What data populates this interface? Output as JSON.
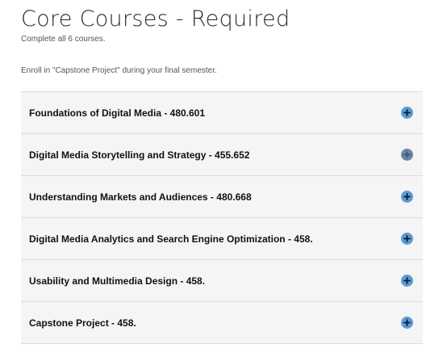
{
  "header": {
    "title": "Core Courses - Required",
    "subtitle": "Complete all 6 courses.",
    "note": "Enroll in \"Capstone Project\" during your final semester."
  },
  "courses": [
    {
      "label": "Foundations of Digital Media - 480.601",
      "icon": "plus-circle-icon"
    },
    {
      "label": "Digital Media Storytelling and Strategy - 455.652",
      "icon": "plus-circle-icon"
    },
    {
      "label": "Understanding Markets and Audiences - 480.668",
      "icon": "plus-circle-icon"
    },
    {
      "label": "Digital Media Analytics and Search Engine Optimization - 458.",
      "icon": "plus-circle-icon"
    },
    {
      "label": "Usability and Multimedia Design - 458.",
      "icon": "plus-circle-icon"
    },
    {
      "label": "Capstone Project - 458.",
      "icon": "plus-circle-icon"
    }
  ],
  "colors": {
    "accent": "#5b9bd5",
    "row_background": "#f5f5f5",
    "divider": "#dcdcdc"
  }
}
